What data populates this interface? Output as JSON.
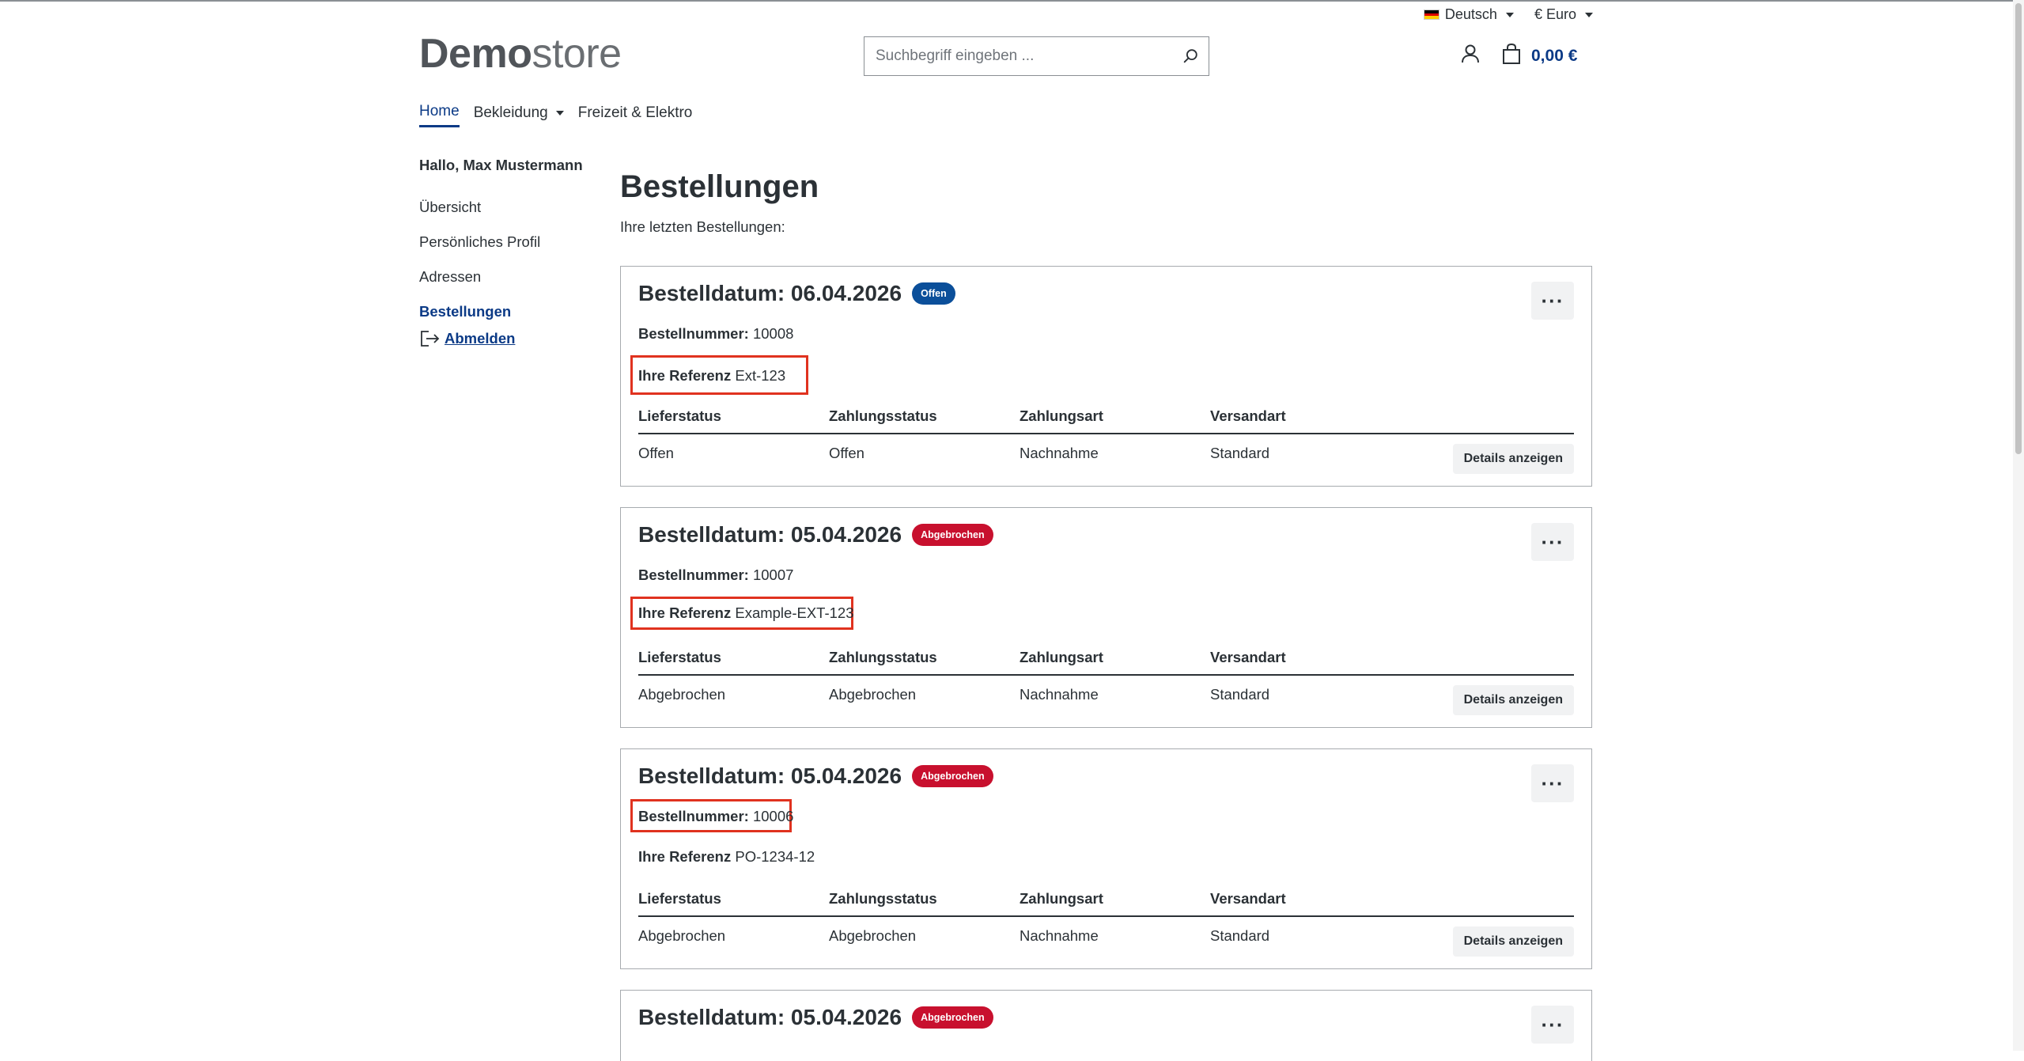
{
  "topbar": {
    "language": "Deutsch",
    "currency": "€ Euro"
  },
  "header": {
    "logo_bold": "Demo",
    "logo_light": "store",
    "search_placeholder": "Suchbegriff eingeben ...",
    "cart_amount": "0,00 €"
  },
  "nav": {
    "items": [
      {
        "label": "Home"
      },
      {
        "label": "Bekleidung"
      },
      {
        "label": "Freizeit & Elektro"
      }
    ]
  },
  "sidebar": {
    "greeting": "Hallo, Max Mustermann",
    "links": [
      {
        "label": "Übersicht"
      },
      {
        "label": "Persönliches Profil"
      },
      {
        "label": "Adressen"
      },
      {
        "label": "Bestellungen"
      }
    ],
    "logout": "Abmelden"
  },
  "main": {
    "title": "Bestellungen",
    "intro": "Ihre letzten Bestellungen:",
    "columns": [
      "Lieferstatus",
      "Zahlungsstatus",
      "Zahlungsart",
      "Versandart"
    ],
    "details_label": "Details anzeigen",
    "number_label": "Bestellnummer:",
    "reference_label": "Ihre Referenz",
    "orders": [
      {
        "date": "Bestelldatum: 06.04.2026",
        "status_badge": "Offen",
        "number": "10008",
        "reference": "Ext-123",
        "delivery_status": "Offen",
        "payment_status": "Offen",
        "payment_method": "Nachnahme",
        "shipping": "Standard"
      },
      {
        "date": "Bestelldatum: 05.04.2026",
        "status_badge": "Abgebrochen",
        "number": "10007",
        "reference": "Example-EXT-123",
        "delivery_status": "Abgebrochen",
        "payment_status": "Abgebrochen",
        "payment_method": "Nachnahme",
        "shipping": "Standard"
      },
      {
        "date": "Bestelldatum: 05.04.2026",
        "status_badge": "Abgebrochen",
        "number": "10006",
        "reference": "PO-1234-12",
        "delivery_status": "Abgebrochen",
        "payment_status": "Abgebrochen",
        "payment_method": "Nachnahme",
        "shipping": "Standard"
      },
      {
        "date": "Bestelldatum: 05.04.2026",
        "status_badge": "Abgebrochen"
      }
    ]
  },
  "colors": {
    "accent": "#0b3a86",
    "badge_open": "#0b4f9a",
    "badge_cancel": "#c8102e",
    "highlight": "#e0321f"
  }
}
